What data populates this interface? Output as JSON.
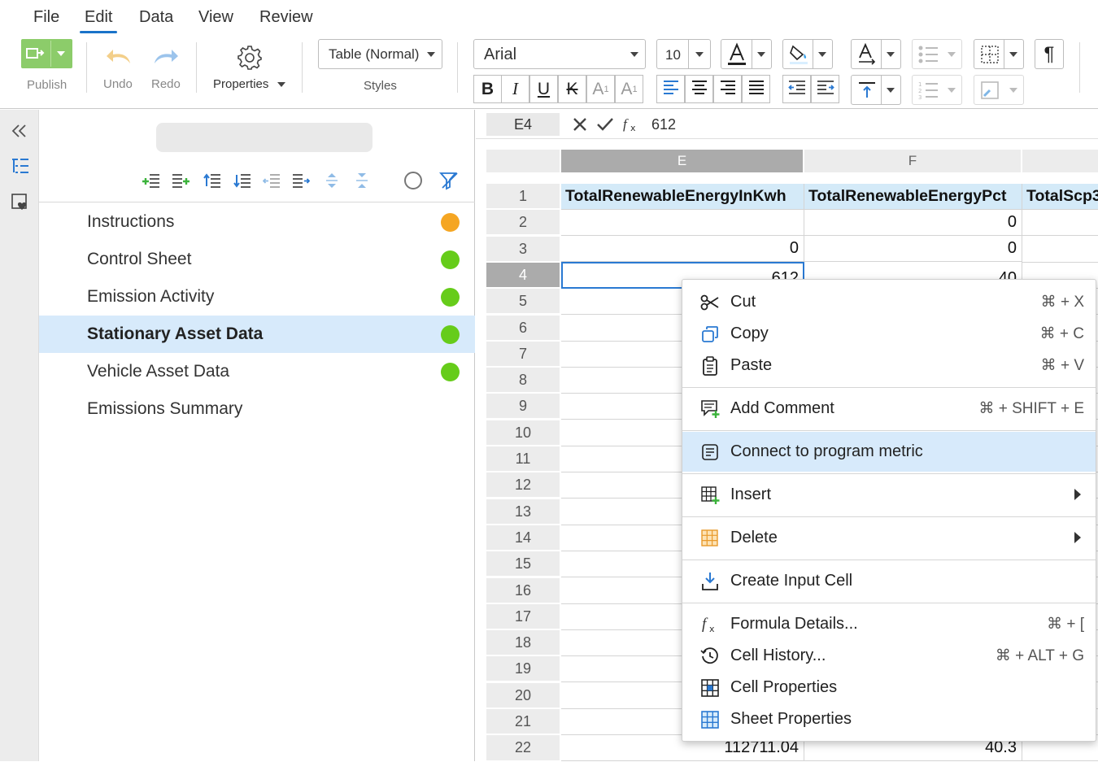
{
  "menubar": {
    "items": [
      {
        "label": "File"
      },
      {
        "label": "Edit"
      },
      {
        "label": "Data"
      },
      {
        "label": "View"
      },
      {
        "label": "Review"
      }
    ],
    "active": "Edit"
  },
  "toolbar": {
    "publish_label": "Publish",
    "undo_label": "Undo",
    "redo_label": "Redo",
    "properties_label": "Properties",
    "style_select": "Table (Normal)",
    "styles_label": "Styles",
    "font_family": "Arial",
    "font_size": "10",
    "bold": "B",
    "italic": "I",
    "underline": "U",
    "strikethrough": "K",
    "superscript": "A",
    "subscript": "A",
    "pilcrow": "¶"
  },
  "sheets": {
    "items": [
      {
        "name": "Instructions",
        "status": "in-progress",
        "color": "#f5a623"
      },
      {
        "name": "Control Sheet",
        "status": "complete",
        "color": "#66cc1a"
      },
      {
        "name": "Emission Activity",
        "status": "complete",
        "color": "#66cc1a"
      },
      {
        "name": "Stationary Asset Data",
        "status": "complete",
        "color": "#66cc1a",
        "selected": true
      },
      {
        "name": "Vehicle Asset Data",
        "status": "complete",
        "color": "#66cc1a"
      },
      {
        "name": "Emissions Summary",
        "status": "none"
      }
    ]
  },
  "formula_bar": {
    "cell_ref": "E4",
    "value": "612"
  },
  "grid": {
    "columns": [
      {
        "label": "E",
        "active": true
      },
      {
        "label": "F",
        "active": false
      },
      {
        "label": "",
        "active": false
      }
    ],
    "rows": [
      "1",
      "2",
      "3",
      "4",
      "5",
      "6",
      "7",
      "8",
      "9",
      "10",
      "11",
      "12",
      "13",
      "14",
      "15",
      "16",
      "17",
      "18",
      "19",
      "20",
      "21",
      "22"
    ],
    "active_row": "4",
    "header_cells": [
      "TotalRenewableEnergyInKwh",
      "TotalRenewableEnergyPct",
      "TotalScp3"
    ],
    "cells": {
      "e2": "",
      "f2": "0",
      "e3": "0",
      "f3": "0",
      "e4": "612",
      "f4": "40",
      "e22": "112711.04",
      "f22": "40.3"
    }
  },
  "context_menu": {
    "items": [
      {
        "label": "Cut",
        "shortcut": "⌘ + X",
        "icon": "scissors-icon"
      },
      {
        "label": "Copy",
        "shortcut": "⌘ + C",
        "icon": "copy-icon"
      },
      {
        "label": "Paste",
        "shortcut": "⌘ + V",
        "icon": "clipboard-icon"
      },
      {
        "label": "Add Comment",
        "shortcut": "⌘ + SHIFT + E",
        "icon": "comment-add-icon"
      },
      {
        "label": "Connect to program metric",
        "shortcut": "",
        "icon": "metric-link-icon",
        "highlighted": true
      },
      {
        "label": "Insert",
        "shortcut": "",
        "icon": "insert-grid-icon",
        "submenu": true
      },
      {
        "label": "Delete",
        "shortcut": "",
        "icon": "delete-grid-icon",
        "submenu": true
      },
      {
        "label": "Create Input Cell",
        "shortcut": "",
        "icon": "input-cell-icon"
      },
      {
        "label": "Formula Details...",
        "shortcut": "⌘ + [",
        "icon": "fx-icon"
      },
      {
        "label": "Cell History...",
        "shortcut": "⌘ + ALT + G",
        "icon": "history-icon"
      },
      {
        "label": "Cell Properties",
        "shortcut": "",
        "icon": "cell-properties-icon"
      },
      {
        "label": "Sheet Properties",
        "shortcut": "",
        "icon": "sheet-properties-icon"
      }
    ]
  },
  "colors": {
    "accent": "#1a73c9",
    "selected_row": "#d7eafb",
    "header_cell": "#d4eaf8",
    "status_complete": "#66cc1a",
    "status_in_progress": "#f5a623",
    "publish_button": "#8ccc6a"
  }
}
